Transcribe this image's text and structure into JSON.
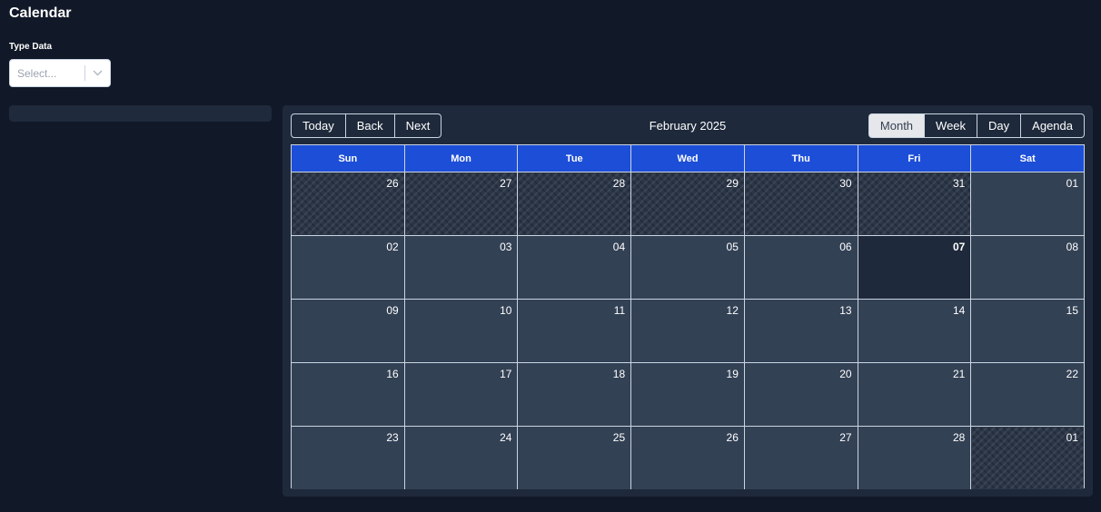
{
  "page": {
    "title": "Calendar"
  },
  "filter": {
    "label": "Type Data",
    "placeholder": "Select..."
  },
  "toolbar": {
    "nav_buttons": [
      "Today",
      "Back",
      "Next"
    ],
    "label": "February 2025",
    "view_buttons": [
      "Month",
      "Week",
      "Day",
      "Agenda"
    ],
    "active_view": "Month"
  },
  "calendar": {
    "weekdays": [
      "Sun",
      "Mon",
      "Tue",
      "Wed",
      "Thu",
      "Fri",
      "Sat"
    ],
    "weeks": [
      [
        {
          "date": "26",
          "state": "off"
        },
        {
          "date": "27",
          "state": "off"
        },
        {
          "date": "28",
          "state": "off"
        },
        {
          "date": "29",
          "state": "off"
        },
        {
          "date": "30",
          "state": "off"
        },
        {
          "date": "31",
          "state": "off"
        },
        {
          "date": "01",
          "state": "in"
        }
      ],
      [
        {
          "date": "02",
          "state": "in"
        },
        {
          "date": "03",
          "state": "in"
        },
        {
          "date": "04",
          "state": "in"
        },
        {
          "date": "05",
          "state": "in"
        },
        {
          "date": "06",
          "state": "in"
        },
        {
          "date": "07",
          "state": "today"
        },
        {
          "date": "08",
          "state": "in"
        }
      ],
      [
        {
          "date": "09",
          "state": "in"
        },
        {
          "date": "10",
          "state": "in"
        },
        {
          "date": "11",
          "state": "in"
        },
        {
          "date": "12",
          "state": "in"
        },
        {
          "date": "13",
          "state": "in"
        },
        {
          "date": "14",
          "state": "in"
        },
        {
          "date": "15",
          "state": "in"
        }
      ],
      [
        {
          "date": "16",
          "state": "in"
        },
        {
          "date": "17",
          "state": "in"
        },
        {
          "date": "18",
          "state": "in"
        },
        {
          "date": "19",
          "state": "in"
        },
        {
          "date": "20",
          "state": "in"
        },
        {
          "date": "21",
          "state": "in"
        },
        {
          "date": "22",
          "state": "in"
        }
      ],
      [
        {
          "date": "23",
          "state": "in"
        },
        {
          "date": "24",
          "state": "in"
        },
        {
          "date": "25",
          "state": "in"
        },
        {
          "date": "26",
          "state": "in"
        },
        {
          "date": "27",
          "state": "in"
        },
        {
          "date": "28",
          "state": "in"
        },
        {
          "date": "01",
          "state": "off"
        }
      ]
    ]
  },
  "colors": {
    "background": "#111827",
    "card": "#1e293b",
    "header_accent": "#1d4ed8",
    "cell": "#334155",
    "today_cell": "#1e293b",
    "active_button": "#e5e7eb"
  },
  "icons": {
    "select_chevron": "chevron-down-icon"
  }
}
